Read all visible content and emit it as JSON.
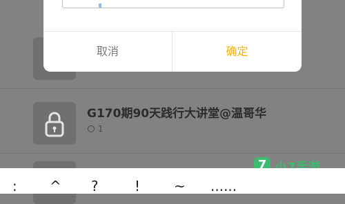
{
  "dialog": {
    "input_value": "",
    "cancel_label": "取消",
    "confirm_label": "确定"
  },
  "list": {
    "item": {
      "title": "G170期90天践行大讲堂@温哥华",
      "views": "1"
    }
  },
  "keyboard": {
    "keys": [
      ":",
      "^",
      "?",
      "!",
      "~",
      "......"
    ]
  },
  "watermark": {
    "logo_char": "7",
    "text": "小7手游"
  },
  "colors": {
    "overlay": "#828282",
    "confirm": "#f4b400",
    "watermark": "#3dbb6f"
  }
}
